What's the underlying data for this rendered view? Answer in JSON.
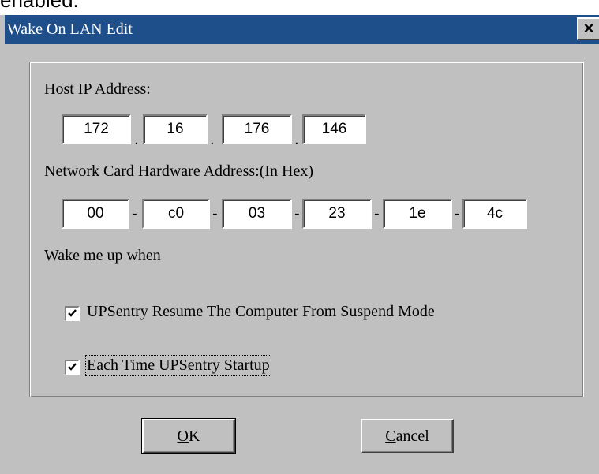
{
  "above_text": "enabled.",
  "window": {
    "title": "Wake On LAN Edit",
    "close_glyph": "×"
  },
  "host_ip": {
    "label": "Host IP Address:",
    "octets": [
      "172",
      "16",
      "176",
      "146"
    ],
    "separator": "."
  },
  "mac": {
    "label": "Network Card Hardware Address:(In Hex)",
    "bytes": [
      "00",
      "c0",
      "03",
      "23",
      "1e",
      "4c"
    ],
    "separator": "-"
  },
  "wake": {
    "label": "Wake me up when",
    "options": [
      {
        "label": "UPSentry Resume The Computer From Suspend Mode",
        "checked": true
      },
      {
        "label": "Each Time UPSentry Startup",
        "checked": true
      }
    ]
  },
  "buttons": {
    "ok_mnemonic": "O",
    "ok_rest": "K",
    "cancel_mnemonic": "C",
    "cancel_rest": "ancel"
  }
}
